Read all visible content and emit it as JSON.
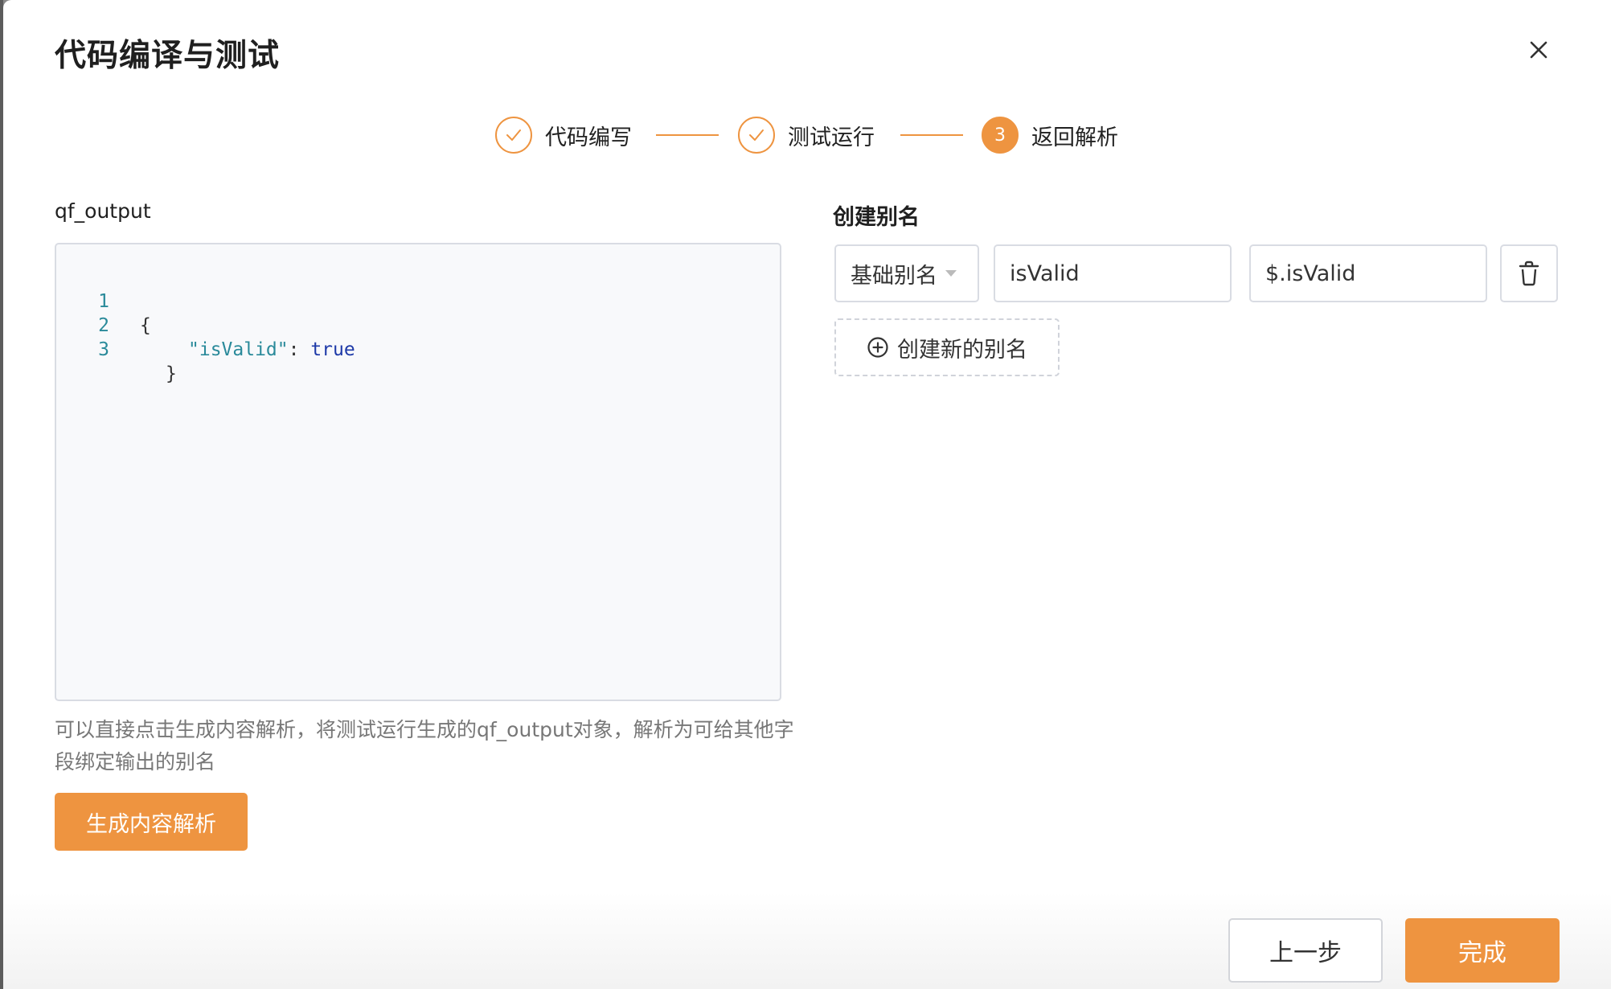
{
  "dialog": {
    "title": "代码编译与测试",
    "close_icon": "close-icon"
  },
  "steps": [
    {
      "label": "代码编写",
      "status": "done",
      "icon": "check-icon"
    },
    {
      "label": "测试运行",
      "status": "done",
      "icon": "check-icon"
    },
    {
      "label": "返回解析",
      "status": "active",
      "number": "3"
    }
  ],
  "left": {
    "section_label": "qf_output",
    "code": {
      "lines": [
        {
          "no": "1",
          "text": "{"
        },
        {
          "no": "2",
          "key": "\"isValid\"",
          "sep": ": ",
          "value": "true"
        },
        {
          "no": "3",
          "text": "}"
        }
      ]
    },
    "help_text": "可以直接点击生成内容解析，将测试运行生成的qf_output对象，解析为可给其他字段绑定输出的别名",
    "generate_button": "生成内容解析"
  },
  "right": {
    "title": "创建别名",
    "alias_rows": [
      {
        "type": "基础别名",
        "name": "isValid",
        "path": "$.isValid",
        "delete_icon": "trash-icon"
      }
    ],
    "add_button": "创建新的别名",
    "add_icon": "plus-circle-icon"
  },
  "footer": {
    "prev_button": "上一步",
    "done_button": "完成"
  },
  "colors": {
    "accent": "#ee9440",
    "code_key": "#2a8a9a",
    "code_bool": "#1e3aa8"
  }
}
